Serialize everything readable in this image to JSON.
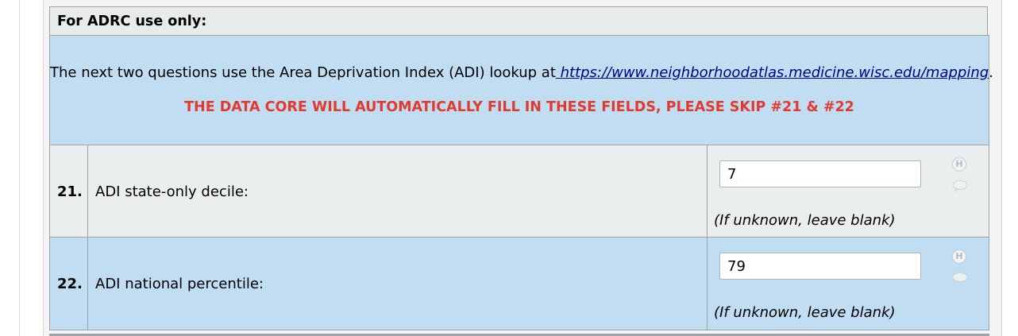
{
  "section_header": "For ADRC use only:",
  "info": {
    "text_before": "The next two questions use the Area Deprivation Index (ADI) lookup at",
    "link_text": " https://www.neighborhoodatlas.medicine.wisc.edu/mapping",
    "text_after": ".",
    "warning": "THE DATA CORE WILL AUTOMATICALLY FILL IN THESE FIELDS, PLEASE SKIP #21 & #22"
  },
  "questions": [
    {
      "number": "21.",
      "label": "ADI state-only decile:",
      "value": "7",
      "note": "(If unknown, leave blank)",
      "history_icon": "H"
    },
    {
      "number": "22.",
      "label": "ADI national percentile:",
      "value": "79",
      "note": "(If unknown, leave blank)",
      "history_icon": "H"
    }
  ],
  "colors": {
    "info_bg": "#c0ddf1",
    "header_bg": "#e8ebeb",
    "warning": "#e23a2e",
    "link": "#00007f"
  }
}
